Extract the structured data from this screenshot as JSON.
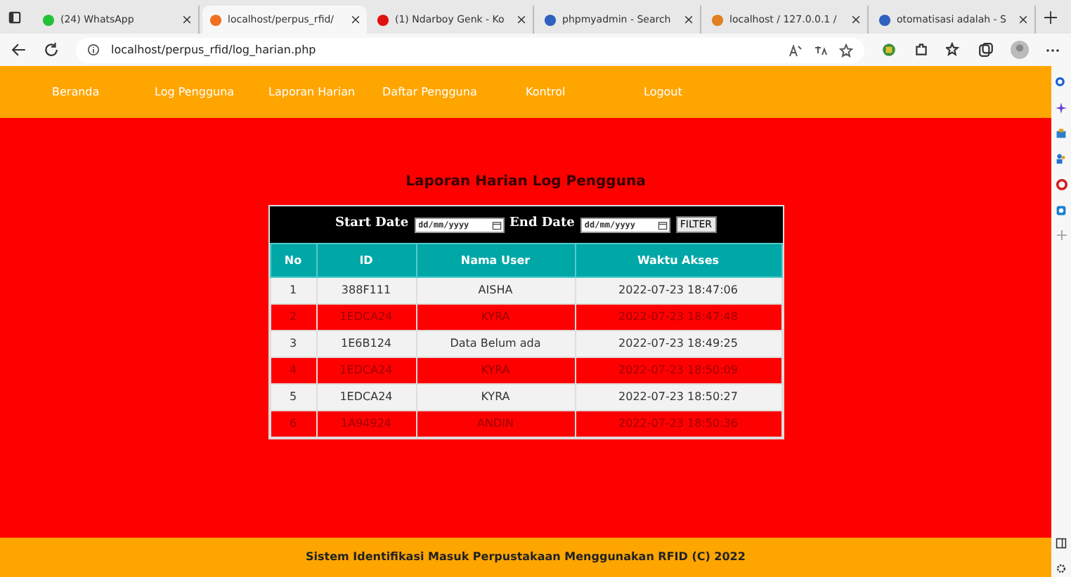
{
  "browser": {
    "tabs": [
      {
        "label": "(24) WhatsApp",
        "selected": false
      },
      {
        "label": "localhost/perpus_rfid/",
        "selected": true
      },
      {
        "label": "(1) Ndarboy Genk - Ko",
        "selected": false
      },
      {
        "label": "phpmyadmin - Search",
        "selected": false
      },
      {
        "label": "localhost / 127.0.0.1 /",
        "selected": false
      },
      {
        "label": "otomatisasi adalah - S",
        "selected": false
      }
    ],
    "address": "localhost/perpus_rfid/log_harian.php"
  },
  "nav": [
    "Beranda",
    "Log Pengguna",
    "Laporan Harian",
    "Daftar Pengguna",
    "Kontrol",
    "Logout"
  ],
  "title": "Laporan Harian Log Pengguna",
  "filter": {
    "start_label": "Start Date",
    "start_placeholder": "dd/mm/yyyy",
    "end_label": "End Date",
    "end_placeholder": "dd/mm/yyyy",
    "button": "FILTER"
  },
  "table": {
    "columns": [
      "No",
      "ID",
      "Nama User",
      "Waktu Akses"
    ],
    "rows": [
      [
        "1",
        "388F111",
        "AISHA",
        "2022-07-23 18:47:06"
      ],
      [
        "2",
        "1EDCA24",
        "KYRA",
        "2022-07-23 18:47:48"
      ],
      [
        "3",
        "1E6B124",
        "Data Belum ada",
        "2022-07-23 18:49:25"
      ],
      [
        "4",
        "1EDCA24",
        "KYRA",
        "2022-07-23 18:50:09"
      ],
      [
        "5",
        "1EDCA24",
        "KYRA",
        "2022-07-23 18:50:27"
      ],
      [
        "6",
        "1A94924",
        "ANDIN",
        "2022-07-23 18:50:36"
      ]
    ]
  },
  "footer": "Sistem Identifikasi Masuk Perpustakaan Menggunakan RFID (C) 2022"
}
